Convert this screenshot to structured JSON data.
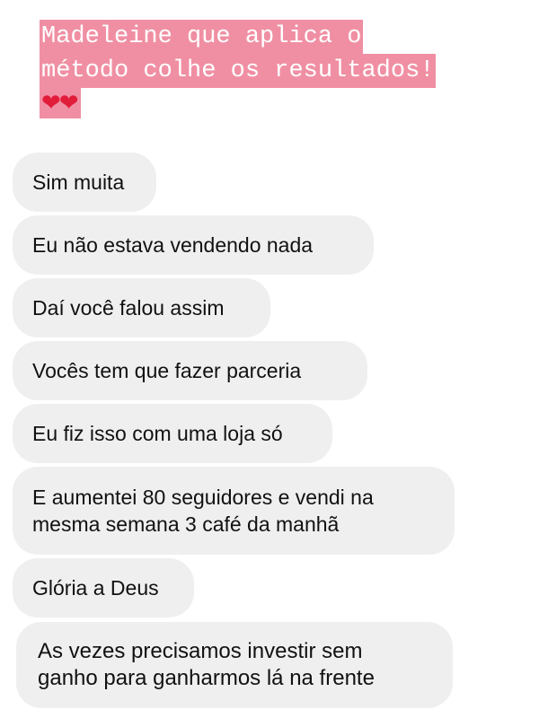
{
  "caption": {
    "line1": "Madeleine que aplica o",
    "line2": "método colhe os resultados!",
    "hearts": "❤❤",
    "highlight_color": "#f08fa3"
  },
  "messages": [
    {
      "text": "Sim muita"
    },
    {
      "text": "Eu não estava vendendo nada"
    },
    {
      "text": "Daí você falou assim"
    },
    {
      "text": "Vocês tem que fazer parceria"
    },
    {
      "text": "Eu fiz isso com uma loja só"
    },
    {
      "line1": "E aumentei 80 seguidores e vendi na",
      "line2": "mesma semana 3 café da manhã"
    },
    {
      "text": "Glória a Deus"
    },
    {
      "line1": "As vezes precisamos investir sem",
      "line2": "ganho para ganharmos lá na frente"
    }
  ],
  "colors": {
    "bubble": "#efefef",
    "text": "#111111",
    "background": "#ffffff"
  }
}
